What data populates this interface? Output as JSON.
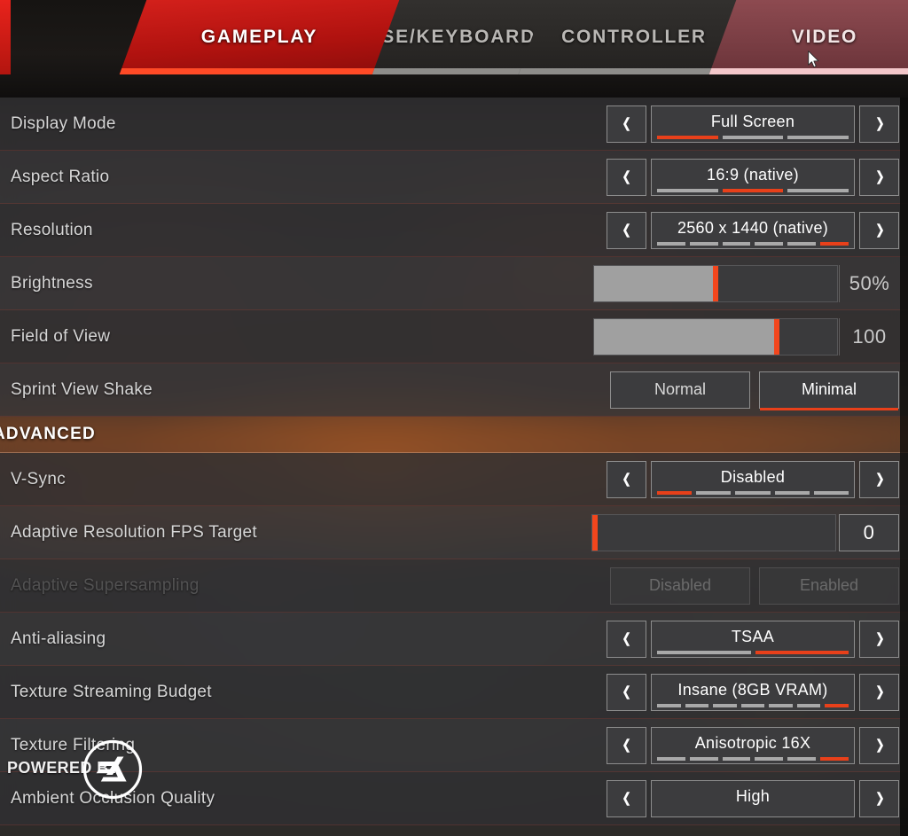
{
  "tabs": [
    {
      "label": "GAMEPLAY",
      "state": "active"
    },
    {
      "label": "MOUSE/KEYBOARD",
      "state": "idle"
    },
    {
      "label": "CONTROLLER",
      "state": "idle"
    },
    {
      "label": "VIDEO",
      "state": "hover"
    }
  ],
  "colors": {
    "accent_red": "#e8401a",
    "tab_active_red": "#d3201b",
    "tab_hover_mauve": "#8d4a50",
    "underline_active": "#ff4a26",
    "underline_hover": "#f3c7ca",
    "underline_idle": "#8e8d8a",
    "row_bg": "#303032",
    "control_bg": "#3c3c3e",
    "control_border": "#8d8d8d",
    "label_text": "#d7d7d7",
    "value_text": "#ffffff",
    "segment_off": "#a9a9a9",
    "slider_fill": "#a0a0a0",
    "slider_knob": "#f2461d",
    "disabled_text": "rgba(176,176,176,0.34)"
  },
  "section_advanced": {
    "title": "ADVANCED"
  },
  "watermark": {
    "powered_by": "POWERED BY",
    "logo": "ea-logo"
  },
  "rows": [
    {
      "label": "Display Mode",
      "type": "stepper",
      "value": "Full Screen",
      "segments_total": 3,
      "segment_active": 1,
      "disabled": false
    },
    {
      "label": "Aspect Ratio",
      "type": "stepper",
      "value": "16:9 (native)",
      "segments_total": 3,
      "segment_active": 2,
      "disabled": false
    },
    {
      "label": "Resolution",
      "type": "stepper",
      "value": "2560 x 1440 (native)",
      "segments_total": 6,
      "segment_active": 6,
      "disabled": false
    },
    {
      "label": "Brightness",
      "type": "slider",
      "value": "50%",
      "fill_percent": 50,
      "boxed_number": false,
      "disabled": false
    },
    {
      "label": "Field of View",
      "type": "slider",
      "value": "100",
      "fill_percent": 75,
      "boxed_number": false,
      "disabled": false
    },
    {
      "label": "Sprint View Shake",
      "type": "toggle",
      "options": [
        {
          "label": "Normal",
          "selected": false
        },
        {
          "label": "Minimal",
          "selected": true
        }
      ],
      "disabled": false
    },
    {
      "label": "V-Sync",
      "type": "stepper",
      "value": "Disabled",
      "segments_total": 5,
      "segment_active": 1,
      "disabled": false
    },
    {
      "label": "Adaptive Resolution FPS Target",
      "type": "slider",
      "value": "0",
      "fill_percent": 0,
      "boxed_number": true,
      "disabled": false
    },
    {
      "label": "Adaptive Supersampling",
      "type": "toggle",
      "options": [
        {
          "label": "Disabled",
          "selected": false
        },
        {
          "label": "Enabled",
          "selected": false
        }
      ],
      "disabled": true
    },
    {
      "label": "Anti-aliasing",
      "type": "stepper",
      "value": "TSAA",
      "segments_total": 2,
      "segment_active": 2,
      "disabled": false
    },
    {
      "label": "Texture Streaming Budget",
      "type": "stepper",
      "value": "Insane (8GB VRAM)",
      "segments_total": 7,
      "segment_active": 7,
      "disabled": false
    },
    {
      "label": "Texture Filtering",
      "type": "stepper",
      "value": "Anisotropic 16X",
      "segments_total": 6,
      "segment_active": 6,
      "disabled": false
    },
    {
      "label": "Ambient Occlusion Quality",
      "type": "stepper",
      "value": "High",
      "segments_total": 0,
      "segment_active": 0,
      "disabled": false
    }
  ],
  "advanced_starts_at_row": 6,
  "icons": {
    "left_arrow": "chevron-left-icon",
    "right_arrow": "chevron-right-icon",
    "cursor": "mouse-cursor-icon"
  }
}
